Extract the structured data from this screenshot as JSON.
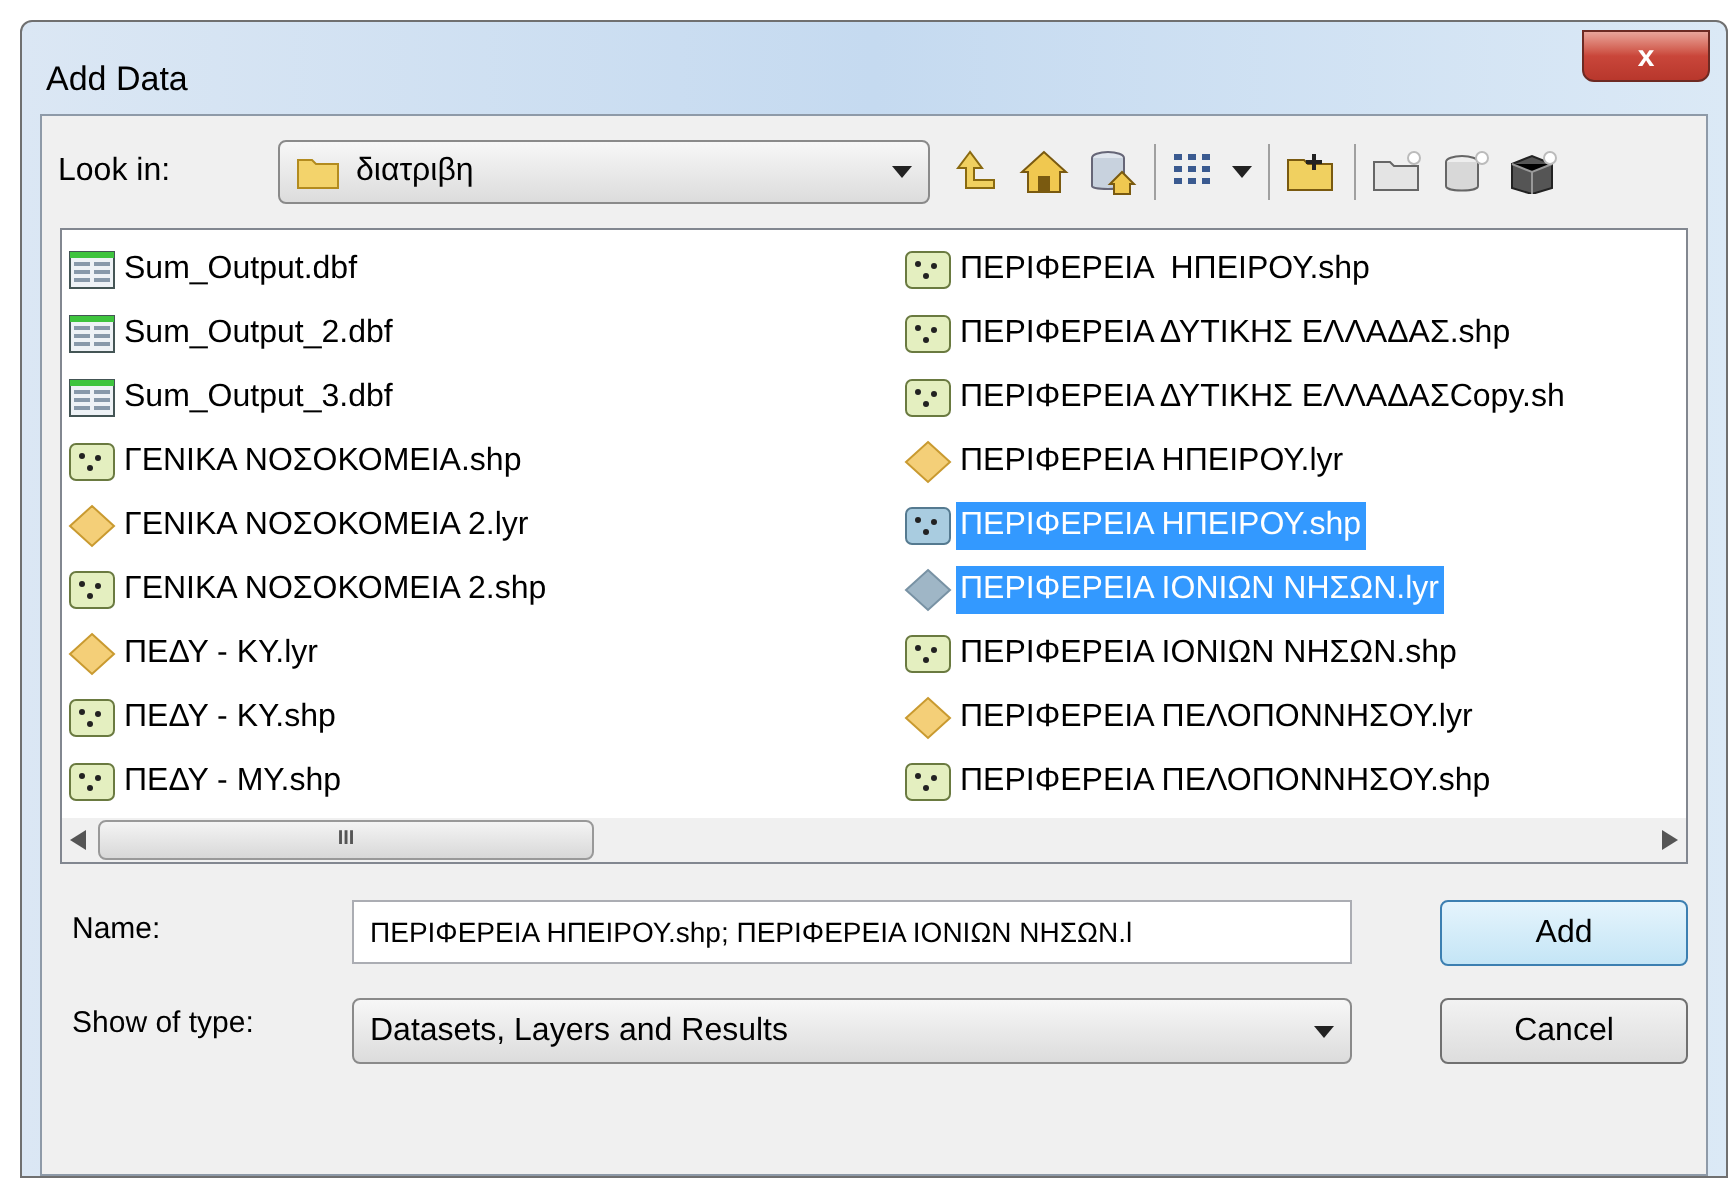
{
  "window": {
    "title": "Add Data",
    "close": "x"
  },
  "look_in": {
    "label": "Look in:",
    "value": "διατριβη"
  },
  "files": [
    {
      "name": "Sum_Output.dbf",
      "kind": "table",
      "selected": false
    },
    {
      "name": "Sum_Output_2.dbf",
      "kind": "table",
      "selected": false
    },
    {
      "name": "Sum_Output_3.dbf",
      "kind": "table",
      "selected": false
    },
    {
      "name": "ΓΕΝΙΚΑ ΝΟΣΟΚΟΜΕΙΑ.shp",
      "kind": "shape",
      "selected": false
    },
    {
      "name": "ΓΕΝΙΚΑ ΝΟΣΟΚΟΜΕΙΑ 2.lyr",
      "kind": "layer",
      "selected": false
    },
    {
      "name": "ΓΕΝΙΚΑ ΝΟΣΟΚΟΜΕΙΑ 2.shp",
      "kind": "shape",
      "selected": false
    },
    {
      "name": "ΠΕΔΥ - ΚΥ.lyr",
      "kind": "layer",
      "selected": false
    },
    {
      "name": "ΠΕΔΥ - ΚΥ.shp",
      "kind": "shape",
      "selected": false
    },
    {
      "name": "ΠΕΔΥ - ΜΥ.shp",
      "kind": "shape",
      "selected": false
    },
    {
      "name": "ΠΕΡΙΦΕΡΕΙΑ  ΗΠΕΙΡΟΥ.shp",
      "kind": "shape",
      "selected": false
    },
    {
      "name": "ΠΕΡΙΦΕΡΕΙΑ ΔΥΤΙΚΗΣ ΕΛΛΑΔΑΣ.shp",
      "kind": "shape",
      "selected": false
    },
    {
      "name": "ΠΕΡΙΦΕΡΕΙΑ ΔΥΤΙΚΗΣ ΕΛΛΑΔΑΣCopy.sh",
      "kind": "shape",
      "selected": false
    },
    {
      "name": "ΠΕΡΙΦΕΡΕΙΑ ΗΠΕΙΡΟΥ.lyr",
      "kind": "layer",
      "selected": false
    },
    {
      "name": "ΠΕΡΙΦΕΡΕΙΑ ΗΠΕΙΡΟΥ.shp",
      "kind": "shape",
      "selected": true
    },
    {
      "name": "ΠΕΡΙΦΕΡΕΙΑ ΙΟΝΙΩΝ ΝΗΣΩΝ.lyr",
      "kind": "layer",
      "selected": true
    },
    {
      "name": "ΠΕΡΙΦΕΡΕΙΑ ΙΟΝΙΩΝ ΝΗΣΩΝ.shp",
      "kind": "shape",
      "selected": false
    },
    {
      "name": "ΠΕΡΙΦΕΡΕΙΑ ΠΕΛΟΠΟΝΝΗΣΟΥ.lyr",
      "kind": "layer",
      "selected": false
    },
    {
      "name": "ΠΕΡΙΦΕΡΕΙΑ ΠΕΛΟΠΟΝΝΗΣΟΥ.shp",
      "kind": "shape",
      "selected": false
    }
  ],
  "scrollbar_grip": "III",
  "name_field": {
    "label": "Name:",
    "value": "ΠΕΡΙΦΕΡΕΙΑ ΗΠΕΙΡΟΥ.shp; ΠΕΡΙΦΕΡΕΙΑ ΙΟΝΙΩΝ ΝΗΣΩΝ.l"
  },
  "type_field": {
    "label": "Show of type:",
    "value": "Datasets, Layers and Results"
  },
  "buttons": [
    {
      "label": "Add",
      "kind": "default"
    },
    {
      "label": "Cancel",
      "kind": "normal"
    }
  ]
}
